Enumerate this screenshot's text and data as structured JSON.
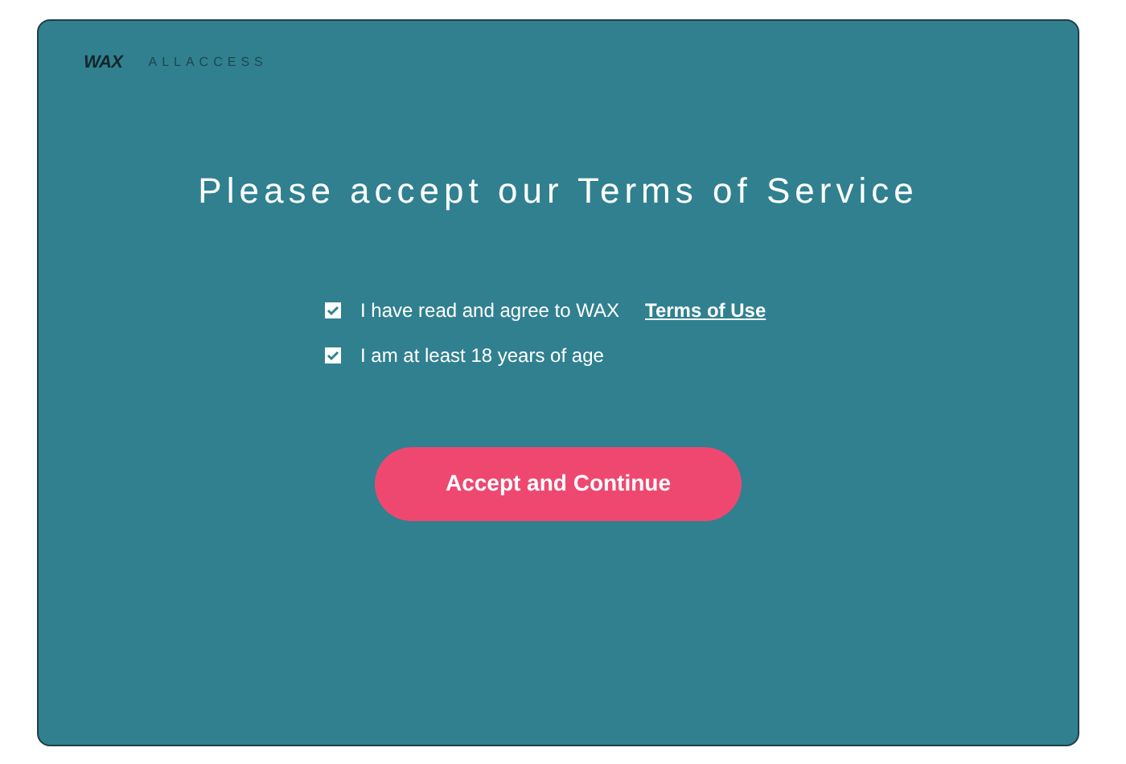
{
  "brand": {
    "logo": "WAX",
    "name": "ALLACCESS"
  },
  "title": "Please accept our Terms of Service",
  "agreements": [
    {
      "text": "I have read and agree to WAX",
      "link": "Terms of Use",
      "checked": true
    },
    {
      "text": "I am at least 18 years of age",
      "checked": true
    }
  ],
  "button": "Accept and Continue"
}
